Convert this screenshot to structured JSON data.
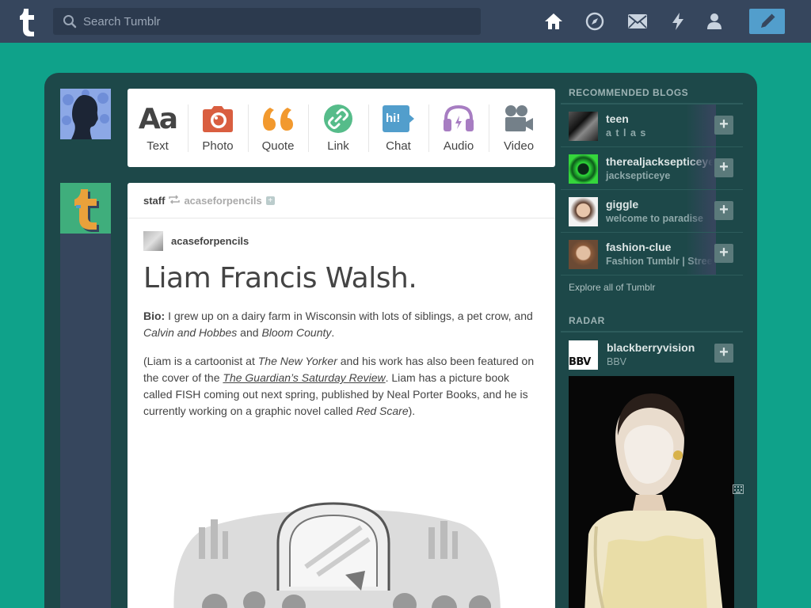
{
  "topbar": {
    "search_placeholder": "Search Tumblr",
    "nav": [
      "home-icon",
      "explore-icon",
      "inbox-icon",
      "activity-icon",
      "account-icon"
    ],
    "compose_icon": "pencil-icon"
  },
  "post_types": [
    {
      "label": "Text",
      "icon": "text-icon"
    },
    {
      "label": "Photo",
      "icon": "camera-icon"
    },
    {
      "label": "Quote",
      "icon": "quote-icon"
    },
    {
      "label": "Link",
      "icon": "link-icon"
    },
    {
      "label": "Chat",
      "icon": "chat-icon",
      "glyph": "hi!"
    },
    {
      "label": "Audio",
      "icon": "headphones-icon"
    },
    {
      "label": "Video",
      "icon": "video-camera-icon"
    }
  ],
  "post": {
    "reblogger": "staff",
    "source": "acaseforpencils",
    "author": "acaseforpencils",
    "title": "Liam Francis Walsh.",
    "bio_label": "Bio:",
    "bio_text_1": " I grew up on a dairy farm in Wisconsin with lots of siblings, a pet crow, and ",
    "bio_em_1": "Calvin and Hobbes",
    "bio_text_2": " and ",
    "bio_em_2": "Bloom County",
    "bio_text_3": ".",
    "p2_text_1": "(Liam is a cartoonist at ",
    "p2_em_1": "The New Yorker",
    "p2_text_2": " and his work has also been featured on the cover of the ",
    "p2_link": "The Guardian’s Saturday Review",
    "p2_text_3": ". Liam has a picture book called FISH coming out next spring, published by Neal Porter Books, and he is currently working on a graphic novel called ",
    "p2_em_2": "Red Scare",
    "p2_text_4": ")."
  },
  "sidebar": {
    "recommended_heading": "RECOMMENDED BLOGS",
    "blogs": [
      {
        "name": "teen",
        "desc": "a t l a s"
      },
      {
        "name": "therealjacksepticeye",
        "desc": "jacksepticeye"
      },
      {
        "name": "giggle",
        "desc": "welcome to paradise"
      },
      {
        "name": "fashion-clue",
        "desc": "Fashion Tumblr | Street"
      }
    ],
    "explore_label": "Explore all of Tumblr",
    "radar_heading": "RADAR",
    "radar": {
      "name": "blackberryvision",
      "desc": "BBV",
      "logo_text": "BBV"
    }
  },
  "colors": {
    "background": "#0fa28a",
    "topbar": "#36465d",
    "dashboard": "#1d4849",
    "compose": "#529ecc"
  }
}
